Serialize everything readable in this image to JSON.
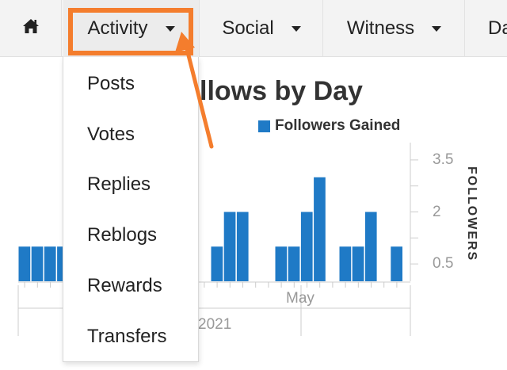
{
  "nav": {
    "home_icon": "home-icon",
    "items": [
      {
        "label": "Activity"
      },
      {
        "label": "Social"
      },
      {
        "label": "Witness"
      },
      {
        "label": "Da"
      }
    ]
  },
  "dropdown": {
    "items": [
      "Posts",
      "Votes",
      "Replies",
      "Reblogs",
      "Rewards",
      "Transfers"
    ]
  },
  "annotation": {
    "color": "#f47d2d"
  },
  "chart_data": {
    "type": "bar",
    "title": "llows by Day",
    "legend": [
      "Followers Gained"
    ],
    "ylabel": "FOLLOWERS",
    "yticks": [
      "0.5",
      "2",
      "3.5"
    ],
    "ylim": [
      0,
      4
    ],
    "y_axis_side": "right",
    "x_label_month": "May",
    "x_label_year": "2021",
    "bar_color": "#1f7ac6",
    "series": [
      {
        "values": [
          1,
          1,
          1,
          1,
          0,
          0,
          0,
          0,
          0,
          0,
          0,
          0,
          0,
          0,
          0,
          1,
          2,
          2,
          0,
          0,
          1,
          1,
          2,
          3,
          0,
          1,
          1,
          2,
          0,
          1
        ]
      }
    ]
  }
}
